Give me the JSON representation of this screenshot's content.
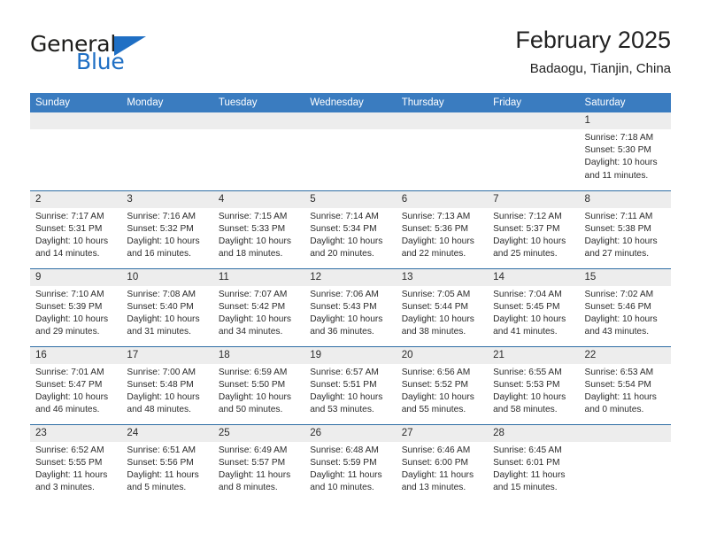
{
  "brand": {
    "name_part1": "General",
    "name_part2": "Blue",
    "accent_color": "#1f6fc4"
  },
  "header": {
    "title": "February 2025",
    "subtitle": "Badaogu, Tianjin, China"
  },
  "theme": {
    "header_row_bg": "#3a7cc0",
    "row_divider": "#2e6da4",
    "daynum_bg": "#ededed",
    "text": "#2b2b2b"
  },
  "columns": [
    "Sunday",
    "Monday",
    "Tuesday",
    "Wednesday",
    "Thursday",
    "Friday",
    "Saturday"
  ],
  "weeks": [
    [
      {
        "day": "",
        "lines": []
      },
      {
        "day": "",
        "lines": []
      },
      {
        "day": "",
        "lines": []
      },
      {
        "day": "",
        "lines": []
      },
      {
        "day": "",
        "lines": []
      },
      {
        "day": "",
        "lines": []
      },
      {
        "day": "1",
        "lines": [
          "Sunrise: 7:18 AM",
          "Sunset: 5:30 PM",
          "Daylight: 10 hours and 11 minutes."
        ]
      }
    ],
    [
      {
        "day": "2",
        "lines": [
          "Sunrise: 7:17 AM",
          "Sunset: 5:31 PM",
          "Daylight: 10 hours and 14 minutes."
        ]
      },
      {
        "day": "3",
        "lines": [
          "Sunrise: 7:16 AM",
          "Sunset: 5:32 PM",
          "Daylight: 10 hours and 16 minutes."
        ]
      },
      {
        "day": "4",
        "lines": [
          "Sunrise: 7:15 AM",
          "Sunset: 5:33 PM",
          "Daylight: 10 hours and 18 minutes."
        ]
      },
      {
        "day": "5",
        "lines": [
          "Sunrise: 7:14 AM",
          "Sunset: 5:34 PM",
          "Daylight: 10 hours and 20 minutes."
        ]
      },
      {
        "day": "6",
        "lines": [
          "Sunrise: 7:13 AM",
          "Sunset: 5:36 PM",
          "Daylight: 10 hours and 22 minutes."
        ]
      },
      {
        "day": "7",
        "lines": [
          "Sunrise: 7:12 AM",
          "Sunset: 5:37 PM",
          "Daylight: 10 hours and 25 minutes."
        ]
      },
      {
        "day": "8",
        "lines": [
          "Sunrise: 7:11 AM",
          "Sunset: 5:38 PM",
          "Daylight: 10 hours and 27 minutes."
        ]
      }
    ],
    [
      {
        "day": "9",
        "lines": [
          "Sunrise: 7:10 AM",
          "Sunset: 5:39 PM",
          "Daylight: 10 hours and 29 minutes."
        ]
      },
      {
        "day": "10",
        "lines": [
          "Sunrise: 7:08 AM",
          "Sunset: 5:40 PM",
          "Daylight: 10 hours and 31 minutes."
        ]
      },
      {
        "day": "11",
        "lines": [
          "Sunrise: 7:07 AM",
          "Sunset: 5:42 PM",
          "Daylight: 10 hours and 34 minutes."
        ]
      },
      {
        "day": "12",
        "lines": [
          "Sunrise: 7:06 AM",
          "Sunset: 5:43 PM",
          "Daylight: 10 hours and 36 minutes."
        ]
      },
      {
        "day": "13",
        "lines": [
          "Sunrise: 7:05 AM",
          "Sunset: 5:44 PM",
          "Daylight: 10 hours and 38 minutes."
        ]
      },
      {
        "day": "14",
        "lines": [
          "Sunrise: 7:04 AM",
          "Sunset: 5:45 PM",
          "Daylight: 10 hours and 41 minutes."
        ]
      },
      {
        "day": "15",
        "lines": [
          "Sunrise: 7:02 AM",
          "Sunset: 5:46 PM",
          "Daylight: 10 hours and 43 minutes."
        ]
      }
    ],
    [
      {
        "day": "16",
        "lines": [
          "Sunrise: 7:01 AM",
          "Sunset: 5:47 PM",
          "Daylight: 10 hours and 46 minutes."
        ]
      },
      {
        "day": "17",
        "lines": [
          "Sunrise: 7:00 AM",
          "Sunset: 5:48 PM",
          "Daylight: 10 hours and 48 minutes."
        ]
      },
      {
        "day": "18",
        "lines": [
          "Sunrise: 6:59 AM",
          "Sunset: 5:50 PM",
          "Daylight: 10 hours and 50 minutes."
        ]
      },
      {
        "day": "19",
        "lines": [
          "Sunrise: 6:57 AM",
          "Sunset: 5:51 PM",
          "Daylight: 10 hours and 53 minutes."
        ]
      },
      {
        "day": "20",
        "lines": [
          "Sunrise: 6:56 AM",
          "Sunset: 5:52 PM",
          "Daylight: 10 hours and 55 minutes."
        ]
      },
      {
        "day": "21",
        "lines": [
          "Sunrise: 6:55 AM",
          "Sunset: 5:53 PM",
          "Daylight: 10 hours and 58 minutes."
        ]
      },
      {
        "day": "22",
        "lines": [
          "Sunrise: 6:53 AM",
          "Sunset: 5:54 PM",
          "Daylight: 11 hours and 0 minutes."
        ]
      }
    ],
    [
      {
        "day": "23",
        "lines": [
          "Sunrise: 6:52 AM",
          "Sunset: 5:55 PM",
          "Daylight: 11 hours and 3 minutes."
        ]
      },
      {
        "day": "24",
        "lines": [
          "Sunrise: 6:51 AM",
          "Sunset: 5:56 PM",
          "Daylight: 11 hours and 5 minutes."
        ]
      },
      {
        "day": "25",
        "lines": [
          "Sunrise: 6:49 AM",
          "Sunset: 5:57 PM",
          "Daylight: 11 hours and 8 minutes."
        ]
      },
      {
        "day": "26",
        "lines": [
          "Sunrise: 6:48 AM",
          "Sunset: 5:59 PM",
          "Daylight: 11 hours and 10 minutes."
        ]
      },
      {
        "day": "27",
        "lines": [
          "Sunrise: 6:46 AM",
          "Sunset: 6:00 PM",
          "Daylight: 11 hours and 13 minutes."
        ]
      },
      {
        "day": "28",
        "lines": [
          "Sunrise: 6:45 AM",
          "Sunset: 6:01 PM",
          "Daylight: 11 hours and 15 minutes."
        ]
      },
      {
        "day": "",
        "lines": []
      }
    ]
  ]
}
